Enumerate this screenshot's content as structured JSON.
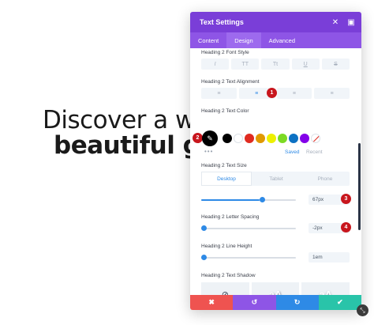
{
  "hero": {
    "line1": "Discover a wo",
    "line2": "beautiful gr"
  },
  "modal": {
    "title": "Text Settings",
    "close_icon": "close-icon",
    "expand_icon": "expand-icon",
    "tabs": [
      {
        "label": "Content"
      },
      {
        "label": "Design"
      },
      {
        "label": "Advanced"
      }
    ],
    "active_tab": "Design",
    "accent_color": "#7a3ed8"
  },
  "font_style": {
    "label": "Heading 2 Font Style",
    "options": [
      "I",
      "TT",
      "Tt",
      "U",
      "S"
    ]
  },
  "text_alignment": {
    "label": "Heading 2 Text Alignment",
    "options": [
      "≡",
      "≡",
      "≡",
      "≡"
    ],
    "marker": "1"
  },
  "text_color": {
    "label": "Heading 2 Text Color",
    "marker": "2",
    "swatches": [
      "#000000",
      "#ffffff",
      "#e02b20",
      "#e09900",
      "#edf000",
      "#7cda24",
      "#0c71c3",
      "#8300e9"
    ],
    "more": "•••",
    "saved_label": "Saved",
    "recent_label": "Recent"
  },
  "text_size": {
    "label": "Heading 2 Text Size",
    "devices": [
      "Desktop",
      "Tablet",
      "Phone"
    ],
    "active_device": "Desktop",
    "value": "67px",
    "slider_fraction": 0.59,
    "marker": "3"
  },
  "letter_spacing": {
    "label": "Heading 2 Letter Spacing",
    "value": "-2px",
    "slider_fraction": 0.03,
    "marker": "4"
  },
  "line_height": {
    "label": "Heading 2 Line Height",
    "value": "1em",
    "slider_fraction": 0.03
  },
  "text_shadow": {
    "label": "Heading 2 Text Shadow",
    "options": [
      "⊘",
      "aA",
      "aA"
    ]
  },
  "footer": {
    "cancel": "✖",
    "undo": "↺",
    "redo": "↻",
    "save": "✔",
    "colors": [
      "#ef5350",
      "#8e55e6",
      "#2e8ae6",
      "#29c4a9"
    ]
  }
}
